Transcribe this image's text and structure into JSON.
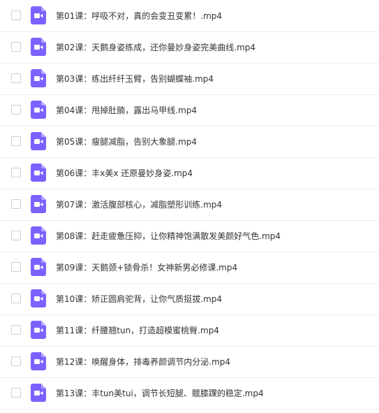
{
  "theme": {
    "icon_color": "#7b61ff",
    "icon_fold_color": "#b4a6ff",
    "text_color": "#333333",
    "divider_color": "#eeeeee",
    "checkbox_border": "#cfcfcf"
  },
  "files": [
    {
      "name": "第01课：呼吸不对，真的会变丑变累！.mp4",
      "icon": "video-file-icon",
      "checked": false
    },
    {
      "name": "第02课：天鹅身姿练成，还你曼妙身姿完美曲线.mp4",
      "icon": "video-file-icon",
      "checked": false
    },
    {
      "name": "第03课：练出纤纤玉臂，告别蝴蝶袖.mp4",
      "icon": "video-file-icon",
      "checked": false
    },
    {
      "name": "第04课：甩掉肚腩，露出马甲线.mp4",
      "icon": "video-file-icon",
      "checked": false
    },
    {
      "name": "第05课：瘦腿减脂，告别大象腿.mp4",
      "icon": "video-file-icon",
      "checked": false
    },
    {
      "name": "第06课：丰x美x 还原曼妙身姿.mp4",
      "icon": "video-file-icon",
      "checked": false
    },
    {
      "name": "第07课：激活腹部核心，减脂塑形训练.mp4",
      "icon": "video-file-icon",
      "checked": false
    },
    {
      "name": "第08课：赶走疲惫压抑，让你精神饱满散发美颜好气色.mp4",
      "icon": "video-file-icon",
      "checked": false
    },
    {
      "name": "第09课：天鹅颈+锁骨杀！女神新男必修课.mp4",
      "icon": "video-file-icon",
      "checked": false
    },
    {
      "name": "第10课：矫正圆肩驼背，让你气质挺拔.mp4",
      "icon": "video-file-icon",
      "checked": false
    },
    {
      "name": "第11课：纤腰翘tun，打造超模蜜桃臀.mp4",
      "icon": "video-file-icon",
      "checked": false
    },
    {
      "name": "第12课：唤醒身体，排毒养颜调节内分泌.mp4",
      "icon": "video-file-icon",
      "checked": false
    },
    {
      "name": "第13课：丰tun美tui，调节长短腿、髋膝踝的稳定.mp4",
      "icon": "video-file-icon",
      "checked": false
    }
  ]
}
